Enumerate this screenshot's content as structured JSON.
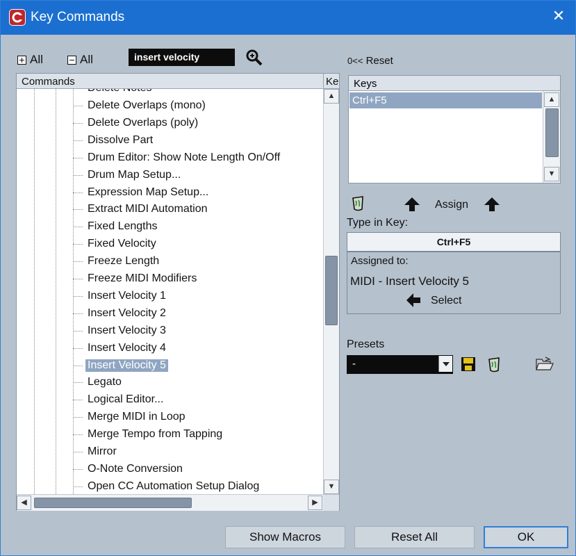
{
  "window": {
    "title": "Key Commands",
    "close_glyph": "✕"
  },
  "toolbar": {
    "expand_all_label": "All",
    "collapse_all_label": "All",
    "search_value": "insert velocity",
    "search_icon": "zoom-search-icon",
    "reset_prefix": "0<<",
    "reset_label": "Reset"
  },
  "commands": {
    "header_commands": "Commands",
    "header_keys": "Ke",
    "partial_top": "Delete Notes",
    "items": [
      "Delete Overlaps (mono)",
      "Delete Overlaps (poly)",
      "Dissolve Part",
      "Drum Editor: Show Note Length On/Off",
      "Drum Map Setup...",
      "Expression Map Setup...",
      "Extract MIDI Automation",
      "Fixed Lengths",
      "Fixed Velocity",
      "Freeze Length",
      "Freeze MIDI Modifiers",
      "Insert Velocity 1",
      "Insert Velocity 2",
      "Insert Velocity 3",
      "Insert Velocity 4",
      "Insert Velocity 5",
      "Legato",
      "Logical Editor...",
      "Merge MIDI in Loop",
      "Merge Tempo from Tapping",
      "Mirror",
      "O-Note Conversion",
      "Open CC Automation Setup Dialog"
    ],
    "selected_index": 15
  },
  "keys": {
    "header": "Keys",
    "items": [
      "Ctrl+F5"
    ],
    "assign_label": "Assign",
    "type_in_key_label": "Type in Key:",
    "type_in_key_value": "Ctrl+F5",
    "assigned_to_label": "Assigned to:",
    "assigned_to_value": "MIDI - Insert Velocity 5",
    "select_label": "Select"
  },
  "presets": {
    "label": "Presets",
    "selected": "-"
  },
  "footer": {
    "show_macros_label": "Show Macros",
    "reset_all_label": "Reset All",
    "ok_label": "OK"
  },
  "colors": {
    "titlebar": "#1b6fd0",
    "panel": "#b5c1cd",
    "selection": "#8fa5c2",
    "accent_border": "#2f7fd6"
  }
}
